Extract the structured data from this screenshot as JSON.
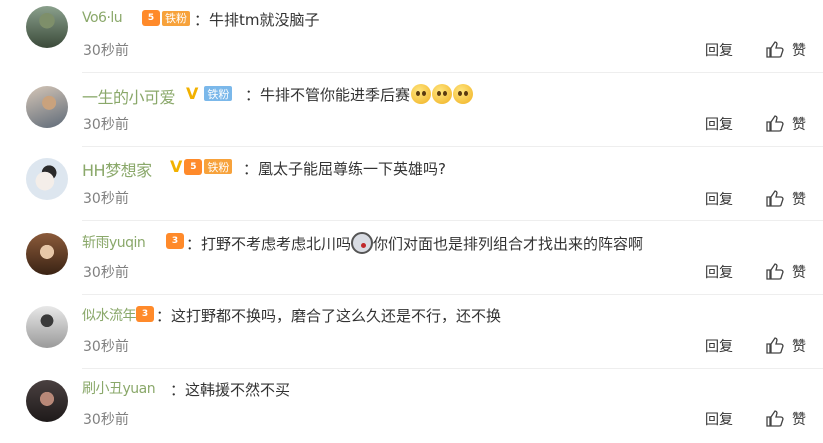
{
  "comments": [
    {
      "name": "Vo6·lu",
      "fan": "铁粉",
      "text": "牛排tm就没脑子",
      "time": "30秒前"
    },
    {
      "name": "一生的小可爱",
      "fan": "铁粉",
      "text": "牛排不管你能进季后赛",
      "time": "30秒前"
    },
    {
      "name": "HH梦想家",
      "fan": "铁粉",
      "text": "凰太子能屈尊练一下英雄吗?",
      "time": "30秒前"
    },
    {
      "name": "斩雨yuqin",
      "text_a": "打野不考虑考虑北川吗",
      "text_b": "你们对面也是排列组合才找出来的阵容啊",
      "time": "30秒前"
    },
    {
      "name": "似水流年",
      "text": "这打野都不换吗，磨合了这么久还是不行，还不换",
      "time": "30秒前"
    },
    {
      "name": "刷小丑yuan",
      "text": "这韩援不然不买",
      "time": "30秒前"
    }
  ],
  "actions": {
    "reply": "回复",
    "like": "赞"
  },
  "colors": {
    "name": "#8aa86a",
    "fan_orange": "#f7a23b",
    "fan_blue": "#7bb8ea",
    "time": "#808080"
  }
}
